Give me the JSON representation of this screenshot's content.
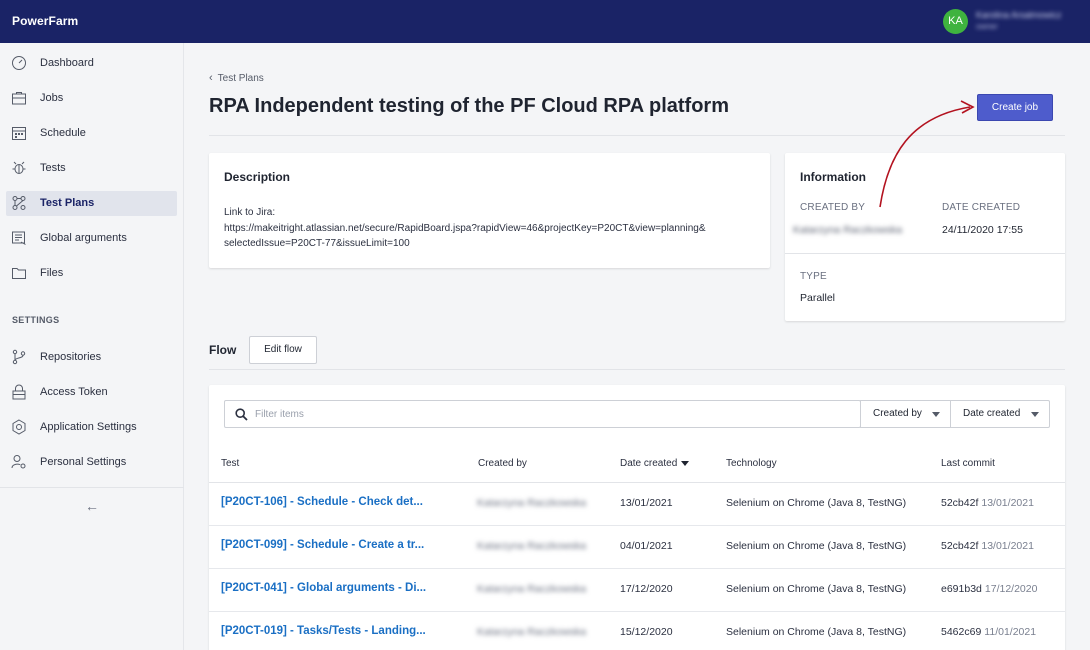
{
  "header": {
    "brand": "PowerFarm",
    "avatar_initials": "KA",
    "user_name": "Karolina Arsalmowicz",
    "user_role": "owner"
  },
  "sidebar": {
    "items": [
      {
        "label": "Dashboard",
        "icon": "dashboard-icon",
        "active": false
      },
      {
        "label": "Jobs",
        "icon": "briefcase-icon",
        "active": false
      },
      {
        "label": "Schedule",
        "icon": "calendar-icon",
        "active": false
      },
      {
        "label": "Tests",
        "icon": "bug-icon",
        "active": false
      },
      {
        "label": "Test Plans",
        "icon": "flow-icon",
        "active": true
      },
      {
        "label": "Global arguments",
        "icon": "list-icon",
        "active": false
      },
      {
        "label": "Files",
        "icon": "folder-icon",
        "active": false
      }
    ],
    "settings_label": "SETTINGS",
    "settings_items": [
      {
        "label": "Repositories",
        "icon": "branch-icon"
      },
      {
        "label": "Access Token",
        "icon": "lock-icon"
      },
      {
        "label": "Application Settings",
        "icon": "gear-icon"
      },
      {
        "label": "Personal Settings",
        "icon": "user-settings-icon"
      }
    ],
    "collapse_glyph": "←"
  },
  "breadcrumb": {
    "label": "Test Plans"
  },
  "page": {
    "title": "RPA Independent testing of the PF Cloud RPA platform",
    "create_job_label": "Create job"
  },
  "description": {
    "title": "Description",
    "lines": [
      "Link to Jira:",
      "https://makeitright.atlassian.net/secure/RapidBoard.jspa?rapidView=46&projectKey=P20CT&view=planning&",
      "selectedIssue=P20CT-77&issueLimit=100"
    ]
  },
  "information": {
    "title": "Information",
    "created_by_label": "CREATED BY",
    "created_by_value": "Katarzyna Raczkowska",
    "date_created_label": "DATE CREATED",
    "date_created_value": "24/11/2020 17:55",
    "type_label": "TYPE",
    "type_value": "Parallel"
  },
  "flow": {
    "title": "Flow",
    "edit_label": "Edit flow",
    "filter_placeholder": "Filter items",
    "filter_value": "",
    "created_by_filter": "Created by",
    "date_created_filter": "Date created",
    "columns": [
      "Test",
      "Created by",
      "Date created",
      "Technology",
      "Last commit"
    ],
    "rows": [
      {
        "test": "[P20CT-106] - Schedule - Check det...",
        "creator": "Katarzyna Raczkowska",
        "date": "13/01/2021",
        "technology": "Selenium on Chrome (Java 8, TestNG)",
        "commit_hash": "52cb42f",
        "commit_date": "13/01/2021"
      },
      {
        "test": "[P20CT-099] - Schedule - Create a tr...",
        "creator": "Katarzyna Raczkowska",
        "date": "04/01/2021",
        "technology": "Selenium on Chrome (Java 8, TestNG)",
        "commit_hash": "52cb42f",
        "commit_date": "13/01/2021"
      },
      {
        "test": "[P20CT-041] - Global arguments - Di...",
        "creator": "Katarzyna Raczkowska",
        "date": "17/12/2020",
        "technology": "Selenium on Chrome (Java 8, TestNG)",
        "commit_hash": "e691b3d",
        "commit_date": "17/12/2020"
      },
      {
        "test": "[P20CT-019] - Tasks/Tests - Landing...",
        "creator": "Katarzyna Raczkowska",
        "date": "15/12/2020",
        "technology": "Selenium on Chrome (Java 8, TestNG)",
        "commit_hash": "5462c69",
        "commit_date": "11/01/2021"
      }
    ]
  },
  "colors": {
    "topbar": "#1a2366",
    "primary_button": "#4e5ccc",
    "link": "#1a6fc4",
    "avatar": "#3fb33f",
    "annotation_arrow": "#b3121f"
  }
}
